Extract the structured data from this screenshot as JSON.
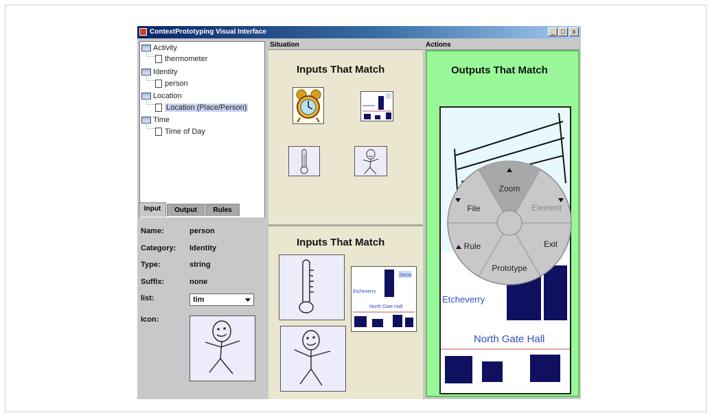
{
  "window": {
    "title": "ContextPrototyping Visual Interface",
    "min_label": "_",
    "max_label": "□",
    "close_label": "x"
  },
  "tree": {
    "items": [
      {
        "label": "Activity",
        "kind": "folder"
      },
      {
        "label": "thermometer",
        "kind": "leaf"
      },
      {
        "label": "Identity",
        "kind": "folder"
      },
      {
        "label": "person",
        "kind": "leaf"
      },
      {
        "label": "Location",
        "kind": "folder"
      },
      {
        "label": "Location (Place/Person)",
        "kind": "leaf",
        "selected": true
      },
      {
        "label": "Time",
        "kind": "folder"
      },
      {
        "label": "Time of Day",
        "kind": "leaf"
      }
    ]
  },
  "tabs": [
    "Input",
    "Output",
    "Rules"
  ],
  "properties": {
    "name_label": "Name:",
    "name_value": "person",
    "category_label": "Category:",
    "category_value": "Identity",
    "type_label": "Type:",
    "type_value": "string",
    "suffix_label": "Suffix:",
    "suffix_value": "none",
    "list_label": "list:",
    "list_value": "tim",
    "icon_label": "Icon:"
  },
  "situation": {
    "header": "Situation",
    "top_title": "Inputs That Match",
    "bottom_title": "Inputs That Match"
  },
  "actions": {
    "header": "Actions",
    "title": "Outputs That Match"
  },
  "map_labels": {
    "street": "Etcheverry",
    "building": "North Gate Hall",
    "corner": "Doca"
  },
  "pie_menu": {
    "top": "Zoom",
    "upper_right": "Element",
    "lower_right": "Exit",
    "bottom": "Prototype",
    "lower_left": "Rule",
    "upper_left": "File"
  },
  "colors": {
    "situation_bg": "#ebe6cf",
    "actions_bg": "#98f898",
    "pie_highlight": "#a8a8a8",
    "pie_bg": "#c8c8c8"
  }
}
